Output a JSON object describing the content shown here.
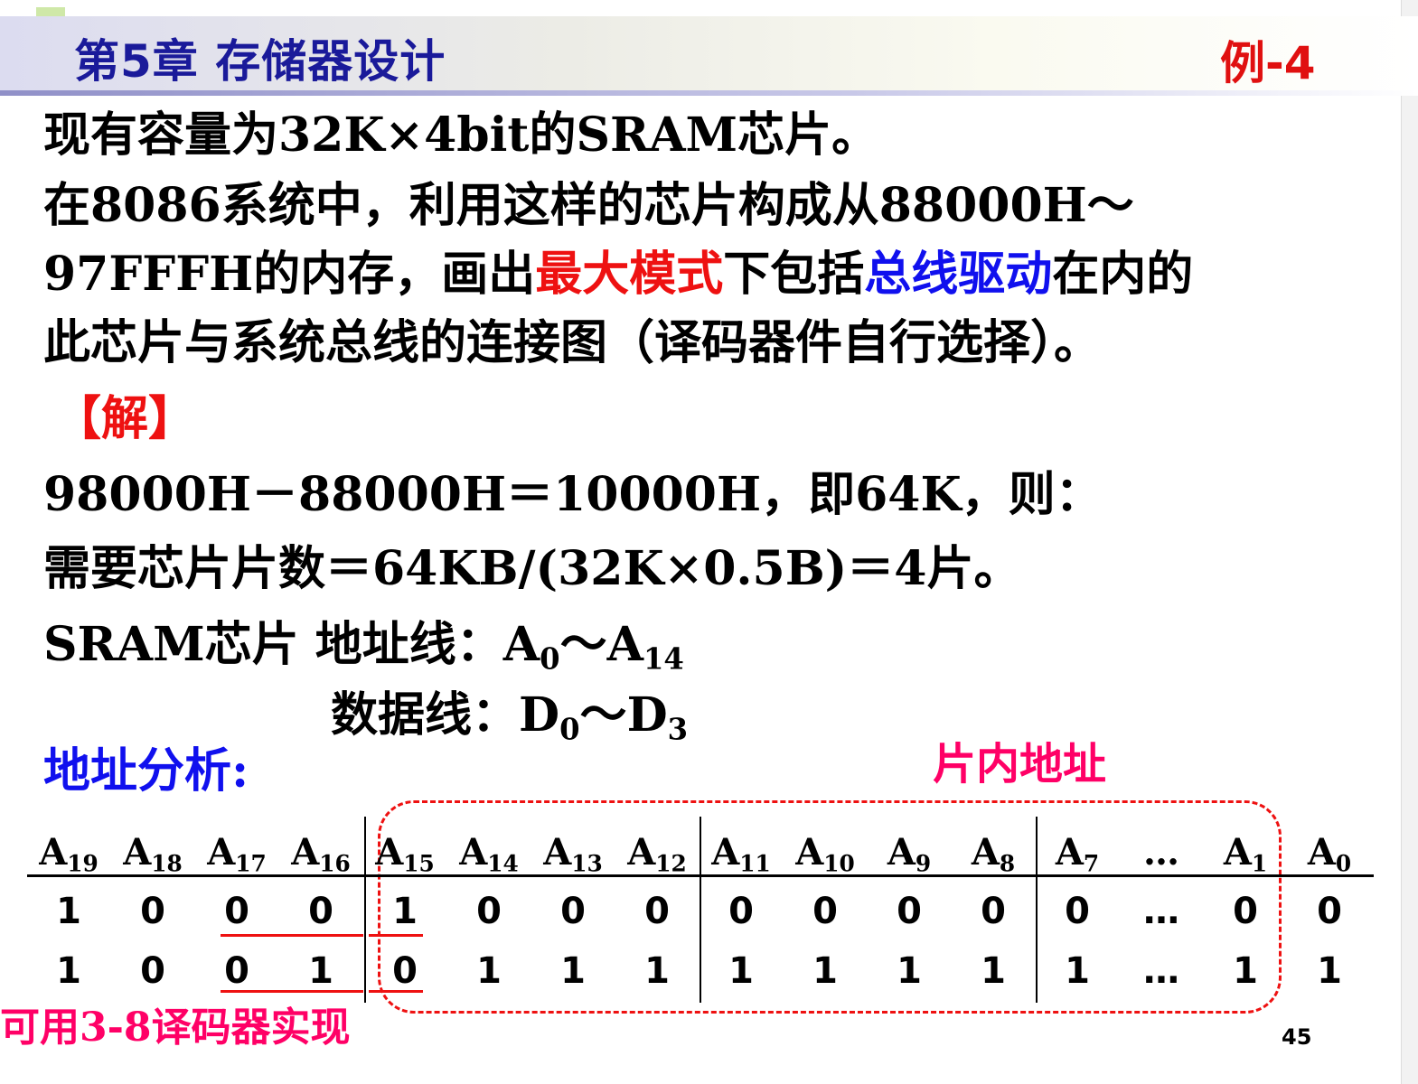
{
  "header": {
    "title": "第5章  存储器设计",
    "example": "例-4"
  },
  "problem": {
    "line1": "现有容量为32K×4bit的SRAM芯片。",
    "line2": "在8086系统中，利用这样的芯片构成从88000H～",
    "line3_a": "97FFFH的内存，画出",
    "line3_b": "最大模式",
    "line3_c": "下包括",
    "line3_d": "总线驱动",
    "line3_e": "在内的",
    "line4": "此芯片与系统总线的连接图（译码器件自行选择）。"
  },
  "solution": {
    "label": "【解】",
    "line1": "98000H－88000H＝10000H，即64K，则：",
    "line2": "需要芯片片数＝64KB/(32K×0.5B)＝4片。",
    "addr_prefix": "SRAM芯片 地址线：",
    "data_prefix": "数据线：",
    "addr_lo": "A",
    "addr_lo_sub": "0",
    "tilde": "～",
    "addr_hi": "A",
    "addr_hi_sub": "14",
    "data_lo": "D",
    "data_lo_sub": "0",
    "data_hi": "D",
    "data_hi_sub": "3"
  },
  "analysis": {
    "label": "地址分析:",
    "in_chip_label": "片内地址",
    "decoder_note": "可用3-8译码器实现",
    "headers": [
      "19",
      "18",
      "17",
      "16",
      "15",
      "14",
      "13",
      "12",
      "11",
      "10",
      "9",
      "8",
      "7",
      "…",
      "1",
      "0"
    ],
    "row1": [
      "1",
      "0",
      "0",
      "0",
      "1",
      "0",
      "0",
      "0",
      "0",
      "0",
      "0",
      "0",
      "0",
      "…",
      "0",
      "0"
    ],
    "row2": [
      "1",
      "0",
      "0",
      "1",
      "0",
      "1",
      "1",
      "1",
      "1",
      "1",
      "1",
      "1",
      "1",
      "…",
      "1",
      "1"
    ]
  },
  "page_number": "45"
}
